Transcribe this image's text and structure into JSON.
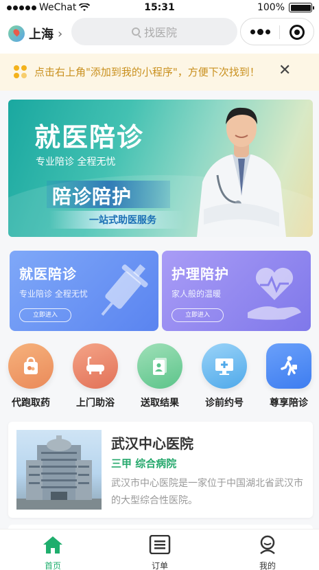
{
  "status_bar": {
    "carrier": "WeChat",
    "time": "15:31",
    "battery": "100%",
    "battery_level": 1.0
  },
  "nav": {
    "city": "上海",
    "search_placeholder": "找医院"
  },
  "tip": {
    "text": "点击右上角\"添加到我的小程序\"，方便下次找到！"
  },
  "hero": {
    "title": "就医陪诊",
    "subtitle": "专业陪诊 全程无忧",
    "badge": "陪诊陪护",
    "strip": "一站式助医服务"
  },
  "services": [
    {
      "title": "就医陪诊",
      "subtitle": "专业陪诊 全程无忧",
      "button": "立即进入"
    },
    {
      "title": "护理陪护",
      "subtitle": "家人般的温暖",
      "button": "立即进入"
    }
  ],
  "shortcuts": [
    {
      "label": "代跑取药",
      "icon": "medicine-bag-icon"
    },
    {
      "label": "上门助浴",
      "icon": "bathtub-icon"
    },
    {
      "label": "送取结果",
      "icon": "report-icon"
    },
    {
      "label": "诊前约号",
      "icon": "monitor-plus-icon"
    },
    {
      "label": "尊享陪诊",
      "icon": "walking-person-icon"
    }
  ],
  "hospital": {
    "name": "武汉中心医院",
    "tags": "三甲  综合病院",
    "description": "武汉市中心医院是一家位于中国湖北省武汉市的大型综合性医院。"
  },
  "tabs": [
    {
      "label": "首页",
      "icon": "home-icon",
      "active": true
    },
    {
      "label": "订单",
      "icon": "list-icon",
      "active": false
    },
    {
      "label": "我的",
      "icon": "user-icon",
      "active": false
    }
  ],
  "colors": {
    "accent": "#1fae6d",
    "tip_text": "#c9901e",
    "tip_bg": "#fdf6e5"
  }
}
